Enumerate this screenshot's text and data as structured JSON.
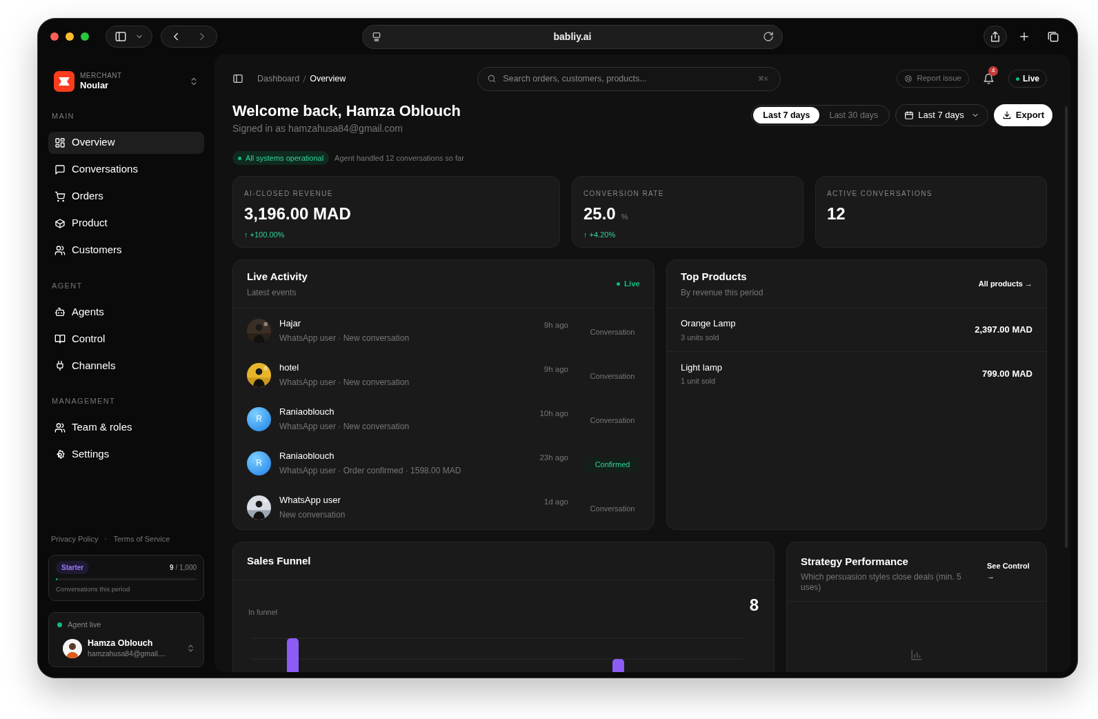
{
  "browser": {
    "address": "babliy.ai"
  },
  "sidebar": {
    "merchant": {
      "label": "MERCHANT",
      "name": "Noular"
    },
    "sections": [
      {
        "title": "MAIN",
        "items": [
          {
            "label": "Overview",
            "selected": true
          },
          {
            "label": "Conversations",
            "selected": false
          },
          {
            "label": "Orders",
            "selected": false
          },
          {
            "label": "Product",
            "selected": false
          },
          {
            "label": "Customers",
            "selected": false
          }
        ]
      },
      {
        "title": "AGENT",
        "items": [
          {
            "label": "Agents",
            "selected": false
          },
          {
            "label": "Control",
            "selected": false
          },
          {
            "label": "Channels",
            "selected": false
          }
        ]
      },
      {
        "title": "MANAGEMENT",
        "items": [
          {
            "label": "Team & roles",
            "selected": false
          },
          {
            "label": "Settings",
            "selected": false
          }
        ]
      }
    ],
    "footer_links": [
      "Privacy Policy",
      "Terms of Service"
    ],
    "plan": {
      "badge": "Starter",
      "count": "9",
      "limit": "/ 1,000",
      "caption": "Conversations this period",
      "level": 0.01
    },
    "agent": {
      "status": "Agent live",
      "name": "Hamza Oblouch",
      "email": "hamzahusa84@gmail...."
    }
  },
  "header": {
    "breadcrumb": [
      "Dashboard",
      "Overview"
    ],
    "search": {
      "placeholder": "Search orders, customers, products...",
      "shortcut": "⌘K"
    },
    "report": "Report issue",
    "notifications": "4",
    "live": "Live"
  },
  "welcome": {
    "title": "Welcome back, Hamza Oblouch",
    "subtitle": "Signed in as hamzahusa84@gmail.com",
    "range_tabs": [
      {
        "label": "Last 7 days",
        "selected": true
      },
      {
        "label": "Last 30 days",
        "selected": false
      }
    ],
    "date_picker": "Last 7 days",
    "export": "Export"
  },
  "status": {
    "badge": "All systems operational",
    "note": "Agent handled 12 conversations so far"
  },
  "kpis": [
    {
      "label": "AI-CLOSED REVENUE",
      "value": "3,196.00 MAD",
      "delta": "↑ +100.00%"
    },
    {
      "label": "CONVERSION RATE",
      "value": "25.0",
      "unit": "%",
      "delta": "↑ +4.20%"
    },
    {
      "label": "ACTIVE CONVERSATIONS",
      "value": "12"
    }
  ],
  "live_activity": {
    "title": "Live Activity",
    "subtitle": "Latest events",
    "live": "Live",
    "events": [
      {
        "name": "Hajar",
        "detail": "WhatsApp user · New conversation",
        "time": "9h ago",
        "tag": "Conversation",
        "kind": "conversation"
      },
      {
        "name": "hotel",
        "detail": "WhatsApp user · New conversation",
        "time": "9h ago",
        "tag": "Conversation",
        "kind": "conversation"
      },
      {
        "name": "Raniaoblouch",
        "detail": "WhatsApp user · New conversation",
        "time": "10h ago",
        "tag": "Conversation",
        "kind": "conversation",
        "avatar": {
          "kind": "initial",
          "initial": "R"
        }
      },
      {
        "name": "Raniaoblouch",
        "detail": "WhatsApp user · Order confirmed · 1598.00 MAD",
        "time": "23h ago",
        "tag": "Confirmed",
        "kind": "confirmed",
        "avatar": {
          "kind": "initial",
          "initial": "R"
        }
      },
      {
        "name": "WhatsApp user",
        "detail": "New conversation",
        "time": "1d ago",
        "tag": "Conversation",
        "kind": "conversation"
      }
    ]
  },
  "top_products": {
    "title": "Top Products",
    "subtitle": "By revenue this period",
    "link": "All products →",
    "products": [
      {
        "name": "Orange Lamp",
        "sold": "3 units sold",
        "revenue": "2,397.00 MAD"
      },
      {
        "name": "Light lamp",
        "sold": "1 unit sold",
        "revenue": "799.00 MAD"
      }
    ]
  },
  "sales_funnel": {
    "title": "Sales Funnel",
    "label": "In funnel",
    "total": "8"
  },
  "strategy": {
    "title": "Strategy Performance",
    "subtitle": "Which persuasion styles close deals (min. 5 uses)",
    "link": "See Control →"
  }
}
